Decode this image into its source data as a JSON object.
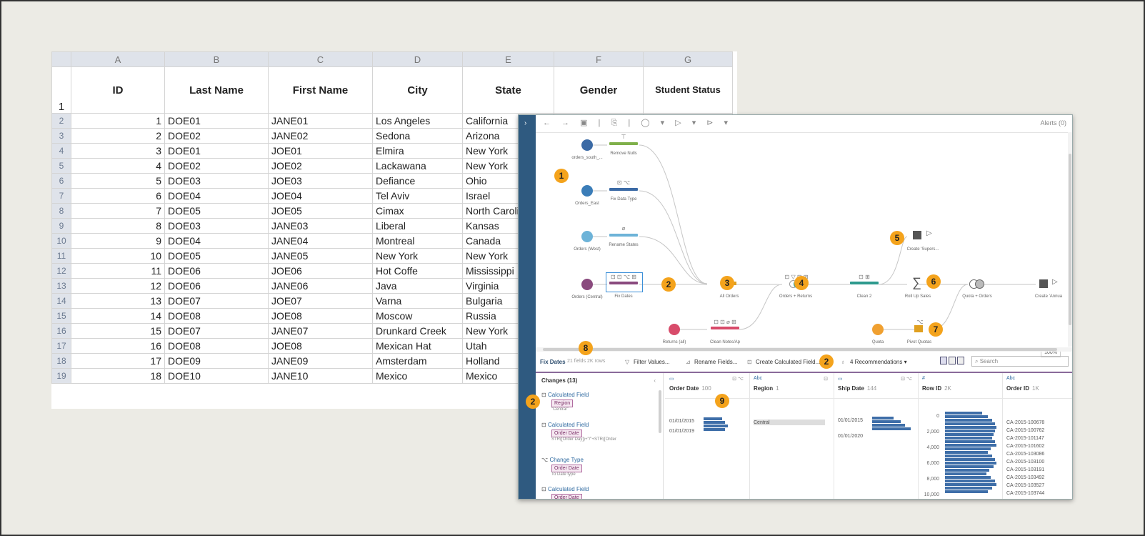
{
  "spreadsheet": {
    "columns": [
      "A",
      "B",
      "C",
      "D",
      "E",
      "F",
      "G"
    ],
    "header_row_num": "1",
    "headers": [
      "ID",
      "Last Name",
      "First Name",
      "City",
      "State",
      "Gender",
      "Student Status"
    ],
    "rows": [
      [
        "2",
        "1",
        "DOE01",
        "JANE01",
        "Los Angeles",
        "California"
      ],
      [
        "3",
        "2",
        "DOE02",
        "JANE02",
        "Sedona",
        "Arizona"
      ],
      [
        "4",
        "3",
        "DOE01",
        "JOE01",
        "Elmira",
        "New York"
      ],
      [
        "5",
        "4",
        "DOE02",
        "JOE02",
        "Lackawana",
        "New York"
      ],
      [
        "6",
        "5",
        "DOE03",
        "JOE03",
        "Defiance",
        "Ohio"
      ],
      [
        "7",
        "6",
        "DOE04",
        "JOE04",
        "Tel Aviv",
        "Israel"
      ],
      [
        "8",
        "7",
        "DOE05",
        "JOE05",
        "Cimax",
        "North Carolina"
      ],
      [
        "9",
        "8",
        "DOE03",
        "JANE03",
        "Liberal",
        "Kansas"
      ],
      [
        "10",
        "9",
        "DOE04",
        "JANE04",
        "Montreal",
        "Canada"
      ],
      [
        "11",
        "10",
        "DOE05",
        "JANE05",
        "New York",
        "New York"
      ],
      [
        "12",
        "11",
        "DOE06",
        "JOE06",
        "Hot Coffe",
        "Mississippi"
      ],
      [
        "13",
        "12",
        "DOE06",
        "JANE06",
        "Java",
        "Virginia"
      ],
      [
        "14",
        "13",
        "DOE07",
        "JOE07",
        "Varna",
        "Bulgaria"
      ],
      [
        "15",
        "14",
        "DOE08",
        "JOE08",
        "Moscow",
        "Russia"
      ],
      [
        "16",
        "15",
        "DOE07",
        "JANE07",
        "Drunkard Creek",
        "New York"
      ],
      [
        "17",
        "16",
        "DOE08",
        "JOE08",
        "Mexican Hat",
        "Utah"
      ],
      [
        "18",
        "17",
        "DOE09",
        "JANE09",
        "Amsterdam",
        "Holland"
      ],
      [
        "19",
        "18",
        "DOE10",
        "JANE10",
        "Mexico",
        "Mexico"
      ]
    ]
  },
  "prep": {
    "topbar": {
      "tools": "← → ▣ | ⎘ | ◯ ▾ ▷ ▾ ⊳ ▾",
      "alerts": "Alerts (0)"
    },
    "nodes": [
      {
        "label": "orders_south_..."
      },
      {
        "label": "Orders_East"
      },
      {
        "label": "Orders (West)"
      },
      {
        "label": "Orders (Central)"
      },
      {
        "label": "Returns (all)"
      },
      {
        "label": "Quota"
      }
    ],
    "steps": [
      {
        "label": "Remove Nulls",
        "icons": "⊤"
      },
      {
        "label": "Fix Data Type",
        "icons": "⊡ ⌥"
      },
      {
        "label": "Rename States",
        "icons": "⌀"
      },
      {
        "label": "Fix Dates",
        "icons": "⊡ ⊡ ⌥ ⊞"
      },
      {
        "label": "Clean Notes/Ap",
        "icons": "⊡ ⊡ ⌀ ⊞"
      },
      {
        "label": "Clean 2",
        "icons": "⊡ ⊞"
      }
    ],
    "other_labels": {
      "all_orders": "All Orders",
      "orders_returns": "Orders + Returns",
      "orders_returns_icons": "⊡ ▽ ⊡ ⊞",
      "create_superstore": "Create 'Supers...",
      "roll_up": "Roll Up Sales",
      "quota_orders": "Quota + Orders",
      "create_annual": "Create 'Annua",
      "pivot_quotas": "Pivot Quotas",
      "pivot_icon": "⌥"
    },
    "badges": [
      "1",
      "2",
      "3",
      "4",
      "5",
      "6",
      "7",
      "8",
      "9",
      "2",
      "2"
    ],
    "zoom": "100%",
    "toolbar": {
      "step_name": "Fix Dates",
      "meta": "21 fields  2K rows",
      "filter": "Filter Values...",
      "rename": "Rename Fields...",
      "calc": "Create Calculated Field...",
      "recs": "4 Recommendations ▾",
      "search": "Search"
    },
    "changes": {
      "title": "Changes (13)",
      "items": [
        {
          "type": "Calculated Field",
          "pill": "Region",
          "detail": "\"Central\""
        },
        {
          "type": "Calculated Field",
          "pill": "Order Date",
          "detail": "STR([Order Day])+\"/\"+STR([Order"
        },
        {
          "type": "Change Type",
          "pill": "Order Date",
          "detail": "To Date type"
        },
        {
          "type": "Calculated Field",
          "pill": "Order Date",
          "detail": ""
        }
      ]
    },
    "profile_columns": [
      {
        "type": "▭",
        "name": "Order Date",
        "count": "100",
        "values": [
          "01/01/2015",
          "01/01/2019"
        ]
      },
      {
        "type": "Abc",
        "name": "Region",
        "count": "1",
        "values": [
          "Central"
        ]
      },
      {
        "type": "▭",
        "name": "Ship Date",
        "count": "144",
        "values": [
          "01/01/2015",
          "01/01/2020"
        ]
      },
      {
        "type": "#",
        "name": "Row ID",
        "count": "2K",
        "values": [
          "0",
          "2,000",
          "4,000",
          "6,000",
          "8,000",
          "10,000"
        ]
      },
      {
        "type": "Abc",
        "name": "Order ID",
        "count": "1K",
        "values": [
          "CA-2015-100678",
          "CA-2015-100762",
          "CA-2015-101147",
          "CA-2015-101602",
          "CA-2015-103086",
          "CA-2015-103100",
          "CA-2015-103191",
          "CA-2015-103492",
          "CA-2015-103527",
          "CA-2015-103744"
        ]
      }
    ]
  }
}
